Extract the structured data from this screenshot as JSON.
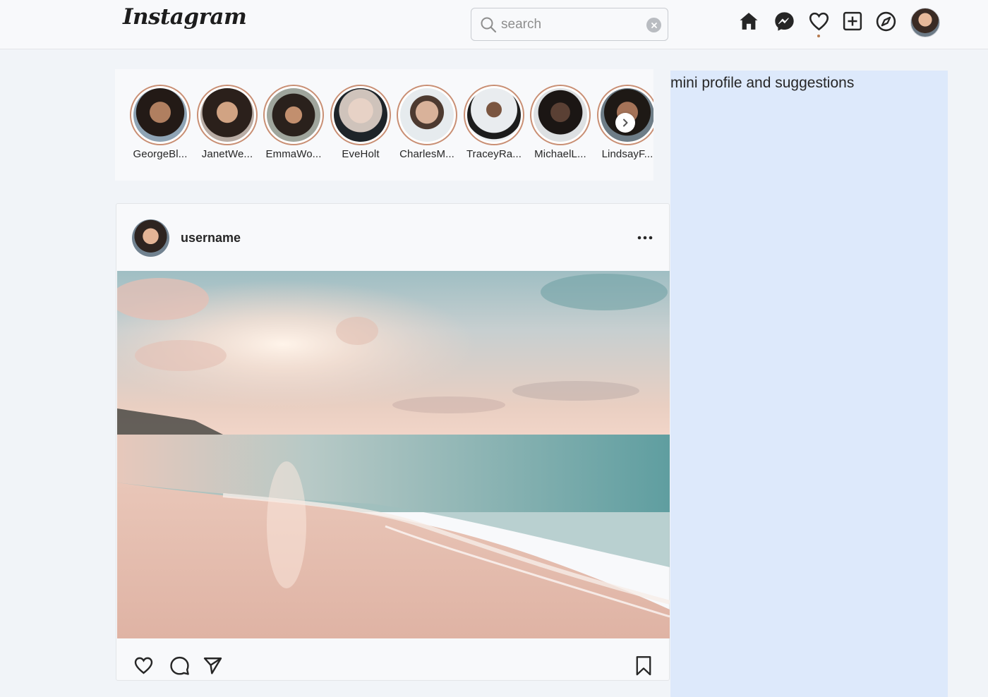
{
  "header": {
    "logo_text": "Instagram",
    "search": {
      "placeholder": "search",
      "value": ""
    },
    "nav_icons": [
      "home-icon",
      "messenger-icon",
      "heart-icon",
      "new-post-icon",
      "explore-icon",
      "profile-avatar"
    ]
  },
  "stories": [
    {
      "name": "GeorgeBl..."
    },
    {
      "name": "JanetWe..."
    },
    {
      "name": "EmmaWo..."
    },
    {
      "name": "EveHolt"
    },
    {
      "name": "CharlesM..."
    },
    {
      "name": "TraceyRa..."
    },
    {
      "name": "MichaelL..."
    },
    {
      "name": "LindsayF..."
    }
  ],
  "post": {
    "username": "username",
    "actions": [
      "heart-icon",
      "comment-icon",
      "share-icon",
      "bookmark-icon"
    ]
  },
  "sidebar": {
    "text": "mini profile and suggestions"
  },
  "colors": {
    "page_bg": "#f1f4f8",
    "card_bg": "#f8f9fb",
    "sidebar_bg": "#dde9fb",
    "story_ring": "#c98f74"
  }
}
